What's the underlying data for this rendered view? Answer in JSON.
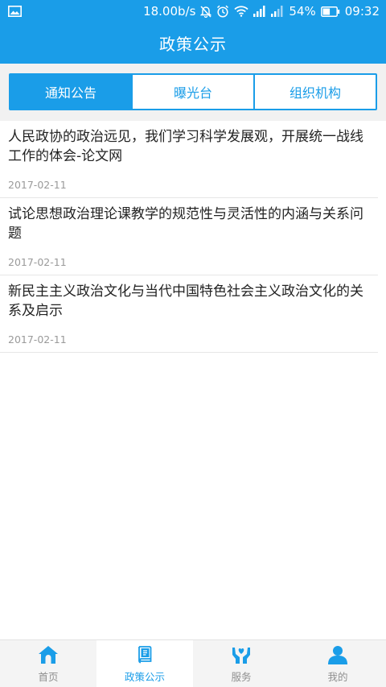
{
  "status_bar": {
    "network_speed": "18.00b/s",
    "battery_percent": "54%",
    "battery_level": 54,
    "time": "09:32",
    "icons": [
      "image-icon",
      "mute-icon",
      "alarm-icon",
      "wifi-icon",
      "signal-icon",
      "signal-secondary-icon",
      "battery-icon"
    ]
  },
  "header": {
    "title": "政策公示"
  },
  "tabs": [
    {
      "label": "通知公告",
      "active": true
    },
    {
      "label": "曝光台",
      "active": false
    },
    {
      "label": "组织机构",
      "active": false
    }
  ],
  "articles": [
    {
      "title": "人民政协的政治远见，我们学习科学发展观，开展统一战线工作的体会-论文网",
      "date": "2017-02-11"
    },
    {
      "title": "试论思想政治理论课教学的规范性与灵活性的内涵与关系问题",
      "date": "2017-02-11"
    },
    {
      "title": "新民主主义政治文化与当代中国特色社会主义政治文化的关系及启示",
      "date": "2017-02-11"
    }
  ],
  "bottom_nav": [
    {
      "label": "首页",
      "icon": "home-icon",
      "active": false
    },
    {
      "label": "政策公示",
      "icon": "policy-book-icon",
      "active": true
    },
    {
      "label": "服务",
      "icon": "service-hands-icon",
      "active": false
    },
    {
      "label": "我的",
      "icon": "user-icon",
      "active": false
    }
  ],
  "colors": {
    "primary": "#1a9de8",
    "nav_inactive": "#8f8f8f",
    "background": "#ffffff",
    "tab_strip_bg": "#f1f1f1"
  }
}
